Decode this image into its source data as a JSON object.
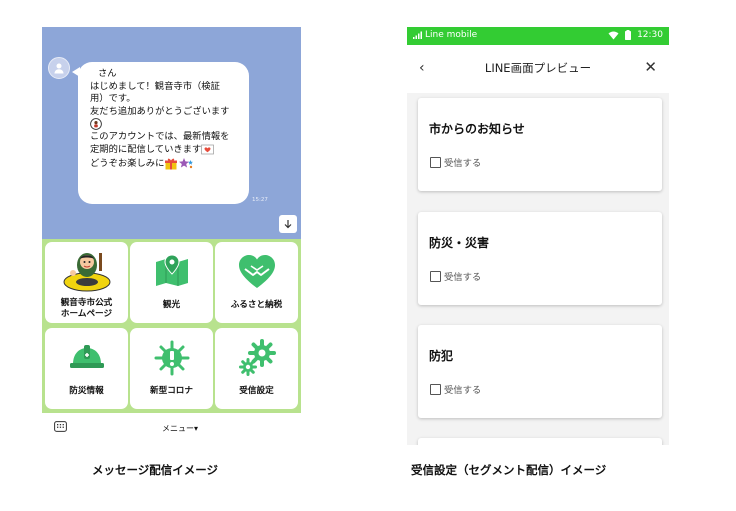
{
  "left_screen": {
    "chat": {
      "greeting_name_suffix": "さん",
      "message_lines": [
        "はじめまして！観音寺市（検証",
        "用）です。",
        "友だち追加ありがとうございます"
      ],
      "message_lines_2": [
        "このアカウントでは、最新情報を",
        "定期的に配信していきます"
      ],
      "closing_line": "どうぞお楽しみに",
      "time": "15:27"
    },
    "rich_menu": {
      "items": [
        {
          "label_line1": "観音寺市公式",
          "label_line2": "ホームページ"
        },
        {
          "label_line1": "観光",
          "label_line2": ""
        },
        {
          "label_line1": "ふるさと納税",
          "label_line2": ""
        },
        {
          "label_line1": "防災情報",
          "label_line2": ""
        },
        {
          "label_line1": "新型コロナ",
          "label_line2": ""
        },
        {
          "label_line1": "受信設定",
          "label_line2": ""
        }
      ]
    },
    "menu_bar": {
      "label": "メニュー▾"
    },
    "caption": "メッセージ配信イメージ"
  },
  "right_screen": {
    "status_bar": {
      "carrier": "Line mobile",
      "time": "12:30"
    },
    "title_bar": {
      "back": "‹",
      "title": "LINE画面プレビュー",
      "close": "✕"
    },
    "segments": [
      {
        "title": "市からのお知らせ",
        "checkbox_label": "受信する"
      },
      {
        "title": "防災・災害",
        "checkbox_label": "受信する"
      },
      {
        "title": "防犯",
        "checkbox_label": "受信する"
      }
    ],
    "caption": "受信設定（セグメント配信）イメージ"
  },
  "colors": {
    "chat_background": "#8da6d8",
    "rich_menu_background": "#b8e28e",
    "status_bar_green": "#33cc33",
    "icon_green": "#3fbf6e"
  }
}
